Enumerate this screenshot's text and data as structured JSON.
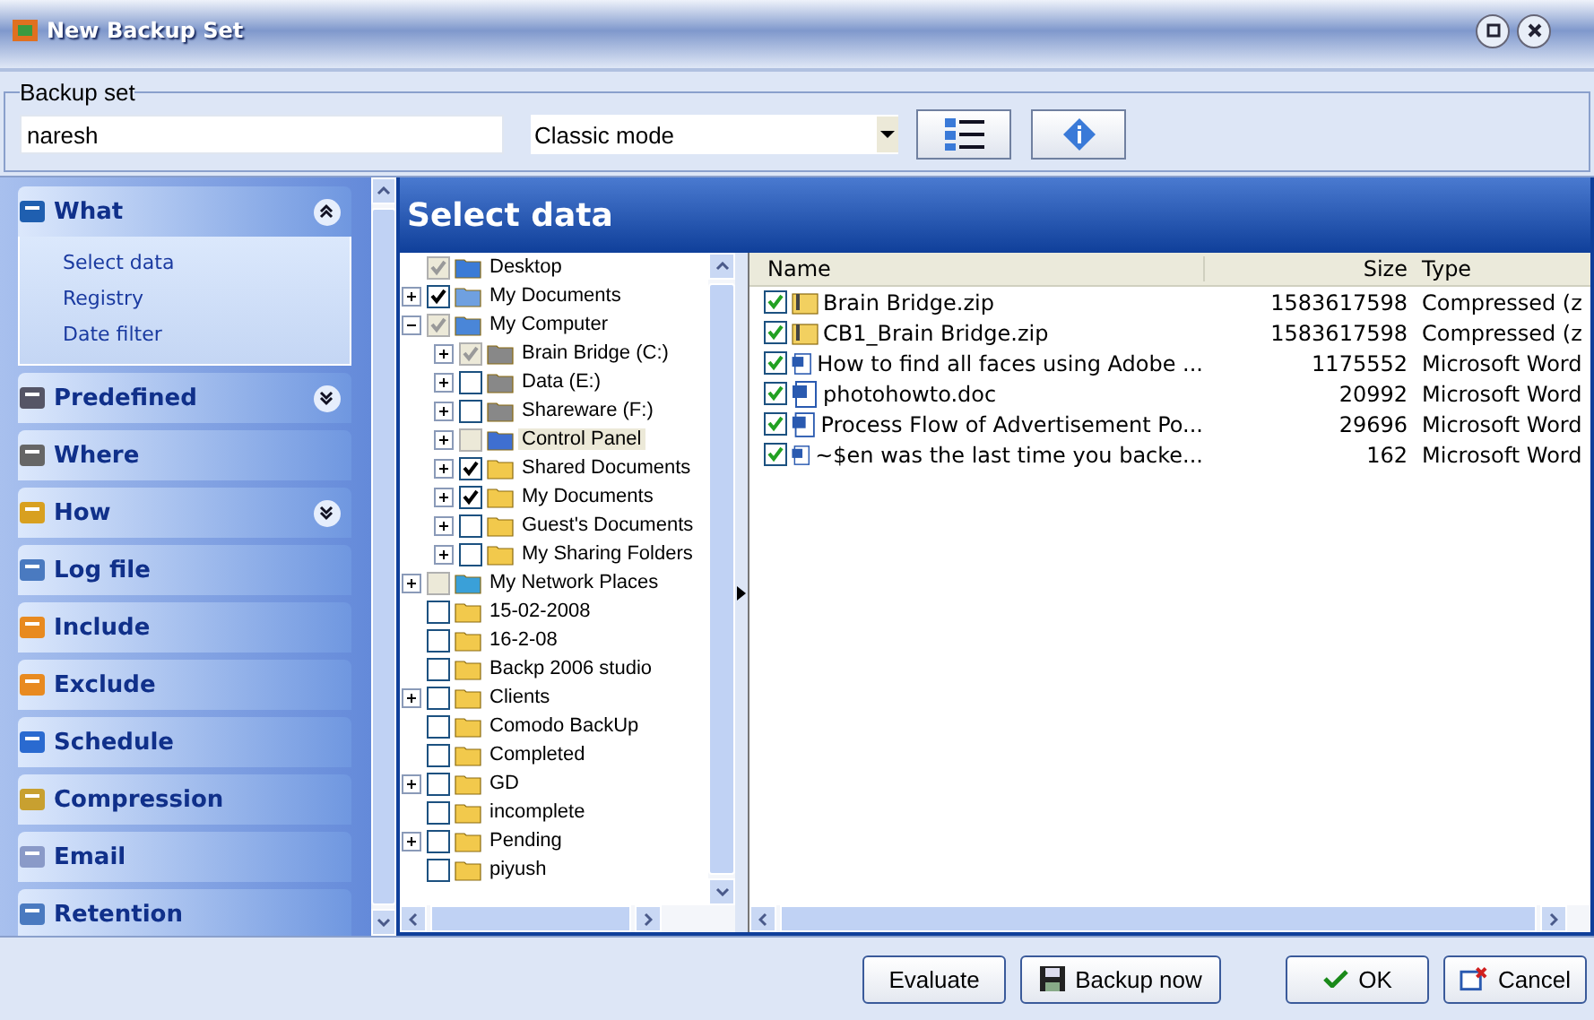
{
  "window": {
    "title": "New Backup Set"
  },
  "backup_set": {
    "label": "Backup set",
    "name": "naresh",
    "mode": "Classic mode"
  },
  "sidebar": {
    "sections": [
      {
        "label": "What",
        "kind": "tree",
        "expanded": true,
        "items": [
          "Select data",
          "Registry",
          "Date filter"
        ]
      },
      {
        "label": "Predefined",
        "kind": "list",
        "expanded": false
      },
      {
        "label": "Where",
        "kind": "drive"
      },
      {
        "label": "How",
        "kind": "gear",
        "expanded": false
      },
      {
        "label": "Log file",
        "kind": "log"
      },
      {
        "label": "Include",
        "kind": "include"
      },
      {
        "label": "Exclude",
        "kind": "exclude"
      },
      {
        "label": "Schedule",
        "kind": "clock"
      },
      {
        "label": "Compression",
        "kind": "clamp"
      },
      {
        "label": "Email",
        "kind": "mail"
      },
      {
        "label": "Retention",
        "kind": "log"
      }
    ]
  },
  "panel_title": "Select data",
  "tree": [
    {
      "label": "Desktop",
      "kind": "desktop",
      "checked": true,
      "greyed": true,
      "selected": false,
      "children": [
        {
          "label": "My Documents",
          "kind": "docs",
          "checked": true,
          "expanded": false,
          "selected": false
        },
        {
          "label": "My Computer",
          "kind": "computer",
          "checked": true,
          "greyed": true,
          "expanded": true,
          "selected": false,
          "children": [
            {
              "label": "Brain Bridge (C:)",
              "kind": "drive",
              "checked": true,
              "greyed": true,
              "expanded": false,
              "selected": false
            },
            {
              "label": "Data (E:)",
              "kind": "drive",
              "checked": false,
              "expanded": false,
              "selected": false
            },
            {
              "label": "Shareware (F:)",
              "kind": "drive",
              "checked": false,
              "expanded": false,
              "selected": false
            },
            {
              "label": "Control Panel",
              "kind": "panel",
              "checked": false,
              "greyed": true,
              "expanded": false,
              "selected": true
            },
            {
              "label": "Shared Documents",
              "kind": "folder",
              "checked": true,
              "expanded": false,
              "selected": false
            },
            {
              "label": "My Documents",
              "kind": "folder",
              "checked": true,
              "expanded": false,
              "selected": false
            },
            {
              "label": "Guest's Documents",
              "kind": "folder",
              "checked": false,
              "expanded": false,
              "selected": false
            },
            {
              "label": "My Sharing Folders",
              "kind": "share",
              "checked": false,
              "expanded": false,
              "selected": false
            }
          ]
        },
        {
          "label": "My Network Places",
          "kind": "network",
          "checked": false,
          "greyed": true,
          "expanded": false,
          "selected": false
        },
        {
          "label": "15-02-2008",
          "kind": "folder",
          "checked": false,
          "selected": false
        },
        {
          "label": "16-2-08",
          "kind": "folder",
          "checked": false,
          "selected": false
        },
        {
          "label": "Backp 2006 studio",
          "kind": "folder",
          "checked": false,
          "selected": false
        },
        {
          "label": "Clients",
          "kind": "folder",
          "checked": false,
          "expanded": false,
          "selected": false
        },
        {
          "label": "Comodo BackUp",
          "kind": "folder",
          "checked": false,
          "selected": false
        },
        {
          "label": "Completed",
          "kind": "folder",
          "checked": false,
          "selected": false
        },
        {
          "label": "GD",
          "kind": "folder",
          "checked": false,
          "expanded": false,
          "selected": false
        },
        {
          "label": "incomplete",
          "kind": "folder",
          "checked": false,
          "selected": false
        },
        {
          "label": "Pending",
          "kind": "folder",
          "checked": false,
          "expanded": false,
          "selected": false
        },
        {
          "label": "piyush",
          "kind": "folder",
          "checked": false,
          "selected": false
        }
      ]
    }
  ],
  "file_list": {
    "columns": [
      "Name",
      "Size",
      "Type"
    ],
    "rows": [
      {
        "name": "Brain Bridge.zip",
        "size": "1583617598",
        "type": "Compressed (z",
        "kind": "zip",
        "checked": true
      },
      {
        "name": "CB1_Brain Bridge.zip",
        "size": "1583617598",
        "type": "Compressed (z",
        "kind": "zip",
        "checked": true
      },
      {
        "name": "How to find all faces using Adobe ...",
        "size": "1175552",
        "type": "Microsoft Word",
        "kind": "doc",
        "checked": true
      },
      {
        "name": "photohowto.doc",
        "size": "20992",
        "type": "Microsoft Word",
        "kind": "doc",
        "checked": true
      },
      {
        "name": "Process Flow of Advertisement Po...",
        "size": "29696",
        "type": "Microsoft Word",
        "kind": "doc",
        "checked": true
      },
      {
        "name": "~$en was the last time you backe...",
        "size": "162",
        "type": "Microsoft Word",
        "kind": "doc",
        "checked": true
      }
    ]
  },
  "buttons": [
    {
      "label": "Evaluate",
      "kind": "plain"
    },
    {
      "label": "Backup now",
      "kind": "disk"
    },
    {
      "label": "OK",
      "kind": "tick"
    },
    {
      "label": "Cancel",
      "kind": "cancel"
    }
  ]
}
